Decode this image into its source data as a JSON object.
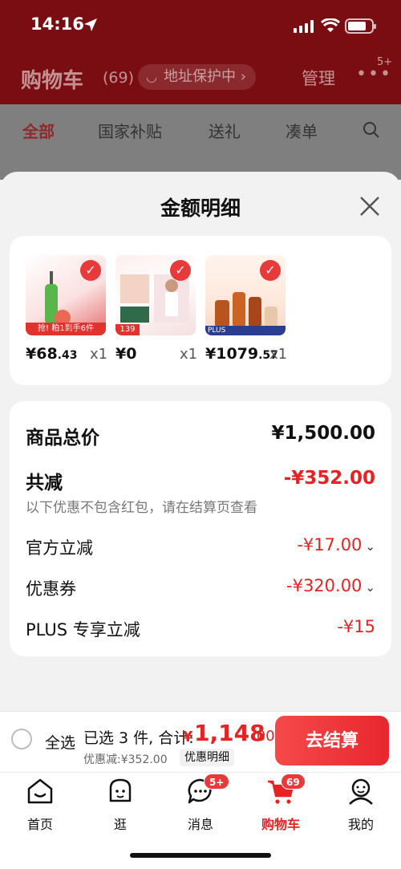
{
  "status": {
    "time": "14:16"
  },
  "header": {
    "title": "购物车",
    "count": "(69)",
    "address": "地址保护中",
    "manage": "管理",
    "more_badge": "5+"
  },
  "bg_tabs": [
    "全部",
    "国家补贴",
    "送礼",
    "凑单"
  ],
  "sheet": {
    "title": "金额明细"
  },
  "products": [
    {
      "price": "¥68",
      "decimal": ".43",
      "qty": "x1",
      "tag": "抢! 粕1到手6件"
    },
    {
      "price": "¥0",
      "decimal": "",
      "qty": "x1",
      "tag": "139"
    },
    {
      "price": "¥1079",
      "decimal": ".57",
      "qty": "x1",
      "tag": "PLUS"
    }
  ],
  "summary": {
    "goods_total_label": "商品总价",
    "goods_total_value": "¥1,500.00",
    "total_discount_label": "共减",
    "total_discount_value": "-¥352.00",
    "note": "以下优惠不包含红包，请在结算页查看",
    "official_label": "官方立减",
    "official_value": "-¥17.00",
    "coupon_label": "优惠券",
    "coupon_value": "-¥320.00",
    "plus_label": "PLUS 专享立减",
    "plus_value": "-¥15"
  },
  "checkout": {
    "select_all": "全选",
    "selected": "已选 3 件, 合计:",
    "yen": "¥",
    "total_int": "1,148",
    "total_dec": ".00",
    "discount_note": "优惠减:¥352.00",
    "detail": "优惠明细",
    "pay": "去结算"
  },
  "tabbar": [
    {
      "label": "首页",
      "badge": ""
    },
    {
      "label": "逛",
      "badge": ""
    },
    {
      "label": "消息",
      "badge": "5+"
    },
    {
      "label": "购物车",
      "badge": "69"
    },
    {
      "label": "我的",
      "badge": ""
    }
  ],
  "colors": {
    "accent": "#e62222",
    "header_bg": "#7a0d12"
  }
}
